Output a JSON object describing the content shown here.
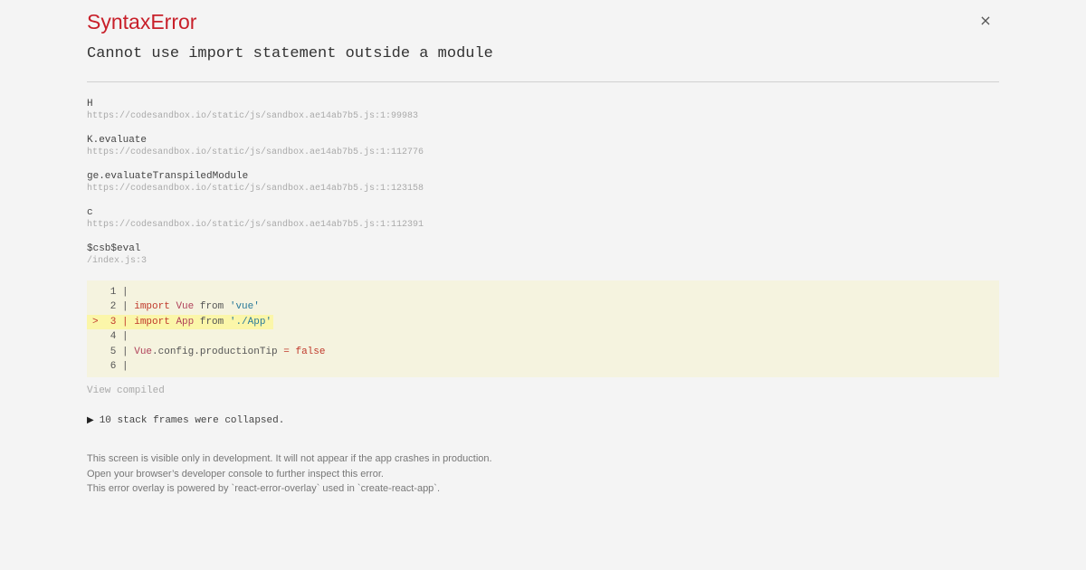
{
  "close_icon": "×",
  "error": {
    "title": "SyntaxError",
    "message": "Cannot use import statement outside a module"
  },
  "stack": [
    {
      "fn": "H",
      "loc": "https://codesandbox.io/static/js/sandbox.ae14ab7b5.js:1:99983"
    },
    {
      "fn": "K.evaluate",
      "loc": "https://codesandbox.io/static/js/sandbox.ae14ab7b5.js:1:112776"
    },
    {
      "fn": "ge.evaluateTranspiledModule",
      "loc": "https://codesandbox.io/static/js/sandbox.ae14ab7b5.js:1:123158"
    },
    {
      "fn": "c",
      "loc": "https://codesandbox.io/static/js/sandbox.ae14ab7b5.js:1:112391"
    },
    {
      "fn": "$csb$eval",
      "loc": "/index.js:3"
    }
  ],
  "code": {
    "lines": [
      {
        "marker": " ",
        "num": "1",
        "tokens": []
      },
      {
        "marker": " ",
        "num": "2",
        "tokens": [
          [
            "kw",
            "import"
          ],
          [
            "p",
            " "
          ],
          [
            "id",
            "Vue"
          ],
          [
            "p",
            " from "
          ],
          [
            "str",
            "'vue'"
          ]
        ]
      },
      {
        "marker": ">",
        "num": "3",
        "highlight": true,
        "tokens": [
          [
            "kw",
            "import"
          ],
          [
            "p",
            " "
          ],
          [
            "id",
            "App"
          ],
          [
            "p",
            " from "
          ],
          [
            "str",
            "'./App'"
          ]
        ]
      },
      {
        "marker": " ",
        "num": "4",
        "tokens": []
      },
      {
        "marker": " ",
        "num": "5",
        "tokens": [
          [
            "id",
            "Vue"
          ],
          [
            "p",
            ".config.productionTip "
          ],
          [
            "kw",
            "="
          ],
          [
            "p",
            " "
          ],
          [
            "kw",
            "false"
          ]
        ]
      },
      {
        "marker": " ",
        "num": "6",
        "tokens": []
      }
    ]
  },
  "view_compiled": "View compiled",
  "collapsed": {
    "icon": "▶",
    "text": "10 stack frames were collapsed."
  },
  "footer": [
    "This screen is visible only in development. It will not appear if the app crashes in production.",
    "Open your browser’s developer console to further inspect this error.",
    "This error overlay is powered by `react-error-overlay` used in `create-react-app`."
  ]
}
